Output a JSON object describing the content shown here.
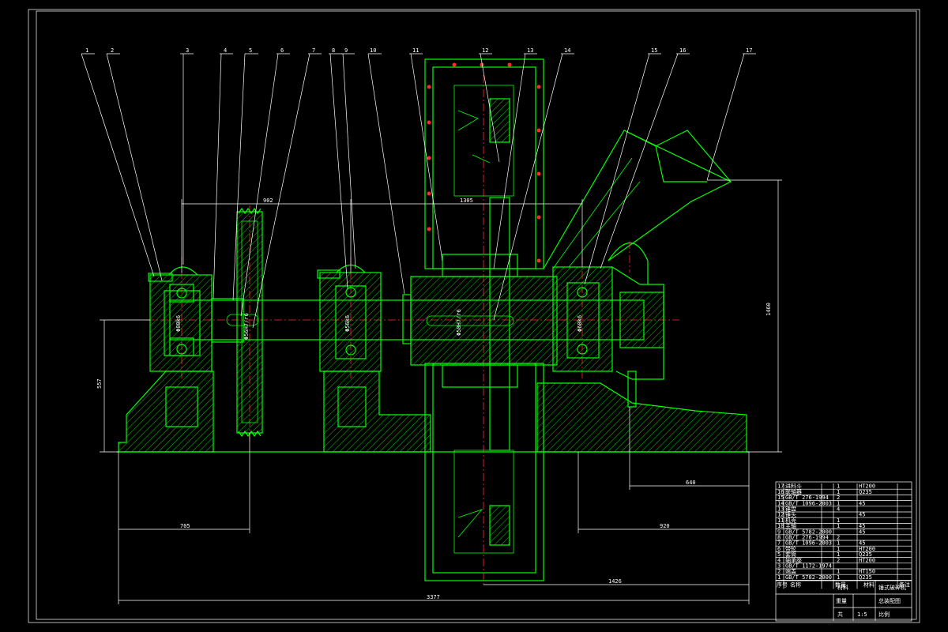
{
  "part_labels": [
    "1",
    "2",
    "3",
    "4",
    "5",
    "6",
    "7",
    "8",
    "9",
    "10",
    "11",
    "12",
    "13",
    "14",
    "15",
    "16",
    "17"
  ],
  "dimensions": {
    "d_1400": "1400",
    "d_902": "902",
    "d_1305": "1305",
    "d_1460": "1460",
    "d_557": "557",
    "d_705": "705",
    "d_640": "640",
    "d_920": "920",
    "d_3377": "3377",
    "d_1426": "1426"
  },
  "fits": [
    "Φ80k6",
    "Φ56k6",
    "Φ60k6",
    "Φ56H7/r6",
    "Φ58H7/r6",
    "Φ75H7/r6",
    "Φ80k6"
  ],
  "title_block": {
    "title_1": "锤式破碎机",
    "title_2": "总装配图",
    "title_3": "材料",
    "title_4": "重量",
    "title_5": "比例",
    "label_jia": "共",
    "label_page": "张",
    "label_sheet": "第",
    "label_sheet2": "张",
    "scale": "1:5"
  },
  "bom_rows": [
    {
      "no": "17",
      "name": "进料斗",
      "qty": "1",
      "mat": "HT200"
    },
    {
      "no": "16",
      "name": "联轴器",
      "qty": "1",
      "mat": "Q235"
    },
    {
      "no": "15",
      "name": "GB/T 276-1994",
      "qty": "2",
      "mat": ""
    },
    {
      "no": "14",
      "name": "GB/T 1096-2003",
      "qty": "1",
      "mat": "45"
    },
    {
      "no": "13",
      "name": "锤盘",
      "qty": "4",
      "mat": ""
    },
    {
      "no": "12",
      "name": "锤头",
      "qty": "",
      "mat": "45"
    },
    {
      "no": "11",
      "name": "机壳",
      "qty": "1",
      "mat": ""
    },
    {
      "no": "10",
      "name": "主轴",
      "qty": "1",
      "mat": "45"
    },
    {
      "no": "9",
      "name": "GB/T 5782-2000",
      "qty": "",
      "mat": "45"
    },
    {
      "no": "8",
      "name": "GB/T 276-1994",
      "qty": "2",
      "mat": ""
    },
    {
      "no": "7",
      "name": "GB/T 1096-2003",
      "qty": "1",
      "mat": "45"
    },
    {
      "no": "6",
      "name": "带轮",
      "qty": "1",
      "mat": "HT200"
    },
    {
      "no": "5",
      "name": "套筒",
      "qty": "1",
      "mat": "Q235"
    },
    {
      "no": "4",
      "name": "轴承座",
      "qty": "2",
      "mat": "HT200"
    },
    {
      "no": "3",
      "name": "GB/T 1172-1974",
      "qty": "",
      "mat": ""
    },
    {
      "no": "2",
      "name": "端盖",
      "qty": "1",
      "mat": "HT150"
    },
    {
      "no": "1",
      "name": "GB/T 5782-2000",
      "qty": "1",
      "mat": "Q235"
    }
  ],
  "header_row": {
    "no": "序号",
    "name": "名称",
    "qty": "数量",
    "mat": "材料",
    "note": "备注"
  },
  "colors": {
    "outline": "#00ff00",
    "text": "#ffffff",
    "centerline": "#ff2a2a",
    "background": "#000000"
  }
}
